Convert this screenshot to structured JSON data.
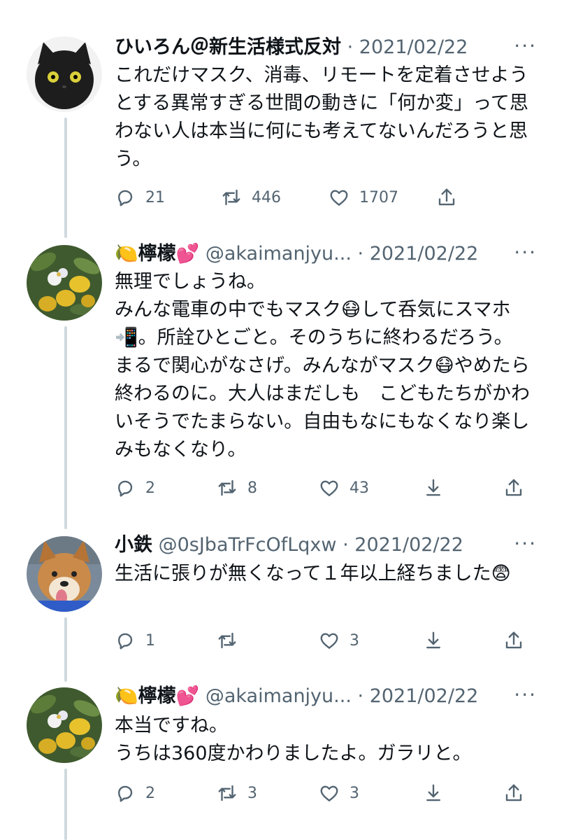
{
  "tweets": [
    {
      "name": "ひいろん＠新生活様式反対",
      "handle": "",
      "dot": "·",
      "date": "2021/02/22",
      "more": "···",
      "text": "これだけマスク、消毒、リモートを定着させようとする異常すぎる世間の動きに「何か変」って思わない人は本当に何にも考えてないんだろうと思う。",
      "reply_count": "21",
      "retweet_count": "446",
      "like_count": "1707"
    },
    {
      "name": "🍋檸檬💕",
      "handle": "@akaimanjyu...",
      "dot": "·",
      "date": "2021/02/22",
      "more": "···",
      "text": "無理でしょうね。\nみんな電車の中でもマスク😷して呑気にスマホ📲。所詮ひとごと。そのうちに終わるだろう。まるで関心がなさげ。みんながマスク😷やめたら終わるのに。大人はまだしも　こどもたちがかわいそうでたまらない。自由もなにもなくなり楽しみもなくなり。",
      "reply_count": "2",
      "retweet_count": "8",
      "like_count": "43"
    },
    {
      "name": "小鉄",
      "handle": "@0sJbaTrFcOfLqxw",
      "dot": "·",
      "date": "2021/02/22",
      "more": "···",
      "text": "生活に張りが無くなって１年以上経ちました😨",
      "reply_count": "1",
      "retweet_count": "",
      "like_count": "3"
    },
    {
      "name": "🍋檸檬💕",
      "handle": "@akaimanjyu...",
      "dot": "·",
      "date": "2021/02/22",
      "more": "···",
      "text": "本当ですね。\nうちは360度かわりましたよ。ガラリと。",
      "reply_count": "2",
      "retweet_count": "3",
      "like_count": "3"
    }
  ],
  "icons": {
    "reply": "reply-icon",
    "retweet": "retweet-icon",
    "like": "heart-icon",
    "download": "download-icon",
    "share": "share-icon"
  },
  "colors": {
    "text": "#0f1419",
    "secondary": "#536471",
    "thread_line": "#cfd9de"
  }
}
